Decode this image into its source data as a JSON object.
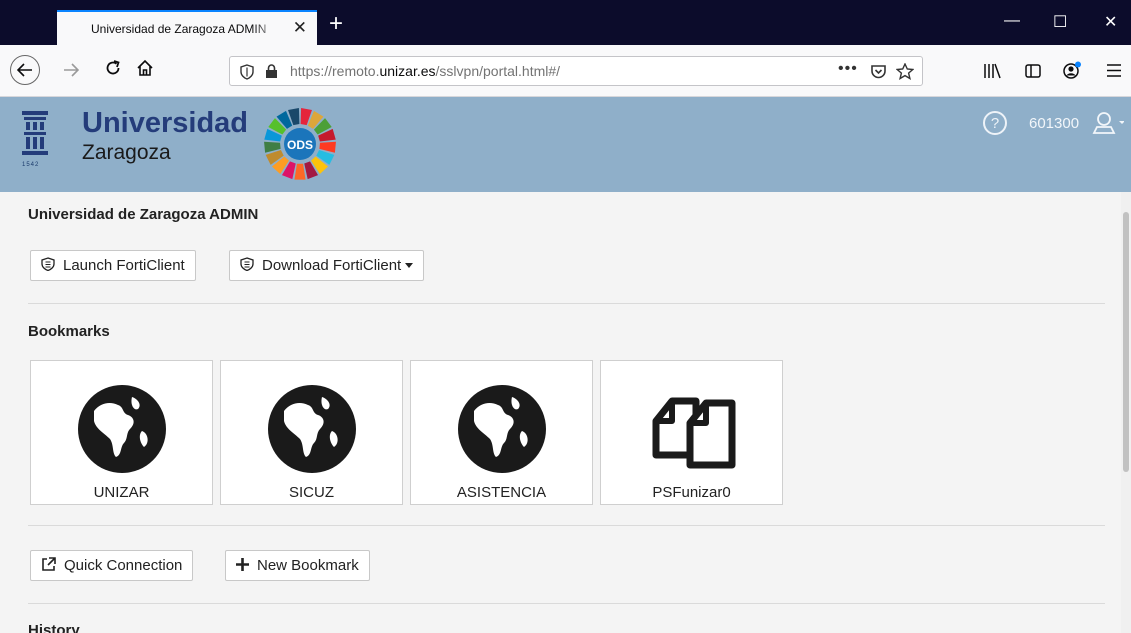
{
  "browser": {
    "tab_title": "Universidad de Zaragoza ADMIN",
    "tab_close": "✕",
    "new_tab": "+",
    "url_prefix": "https://remoto.",
    "url_domain": "unizar.es",
    "url_path": "/sslvpn/portal.html#/",
    "win_minimize": "—",
    "win_maximize": "☐",
    "win_close": "✕"
  },
  "header": {
    "logo_title": "Universidad",
    "logo_subtitle": "Zaragoza",
    "logo_year": "1542",
    "ods_label": "ODS",
    "help": "?",
    "user_id": "601300"
  },
  "portal": {
    "title": "Universidad de Zaragoza ADMIN",
    "launch_label": "Launch FortiClient",
    "download_label": "Download FortiClient",
    "bookmarks_title": "Bookmarks",
    "bookmarks": [
      {
        "label": "UNIZAR",
        "icon": "globe-icon"
      },
      {
        "label": "SICUZ",
        "icon": "globe-icon"
      },
      {
        "label": "ASISTENCIA",
        "icon": "globe-icon"
      },
      {
        "label": "PSFunizar0",
        "icon": "copy-files-icon"
      }
    ],
    "quick_connection_label": "Quick Connection",
    "new_bookmark_label": "New Bookmark",
    "history_title": "History"
  },
  "colors": {
    "header_bg": "#8fafc9",
    "brand_blue": "#243c7a",
    "page_bg": "#f4f4f4"
  }
}
